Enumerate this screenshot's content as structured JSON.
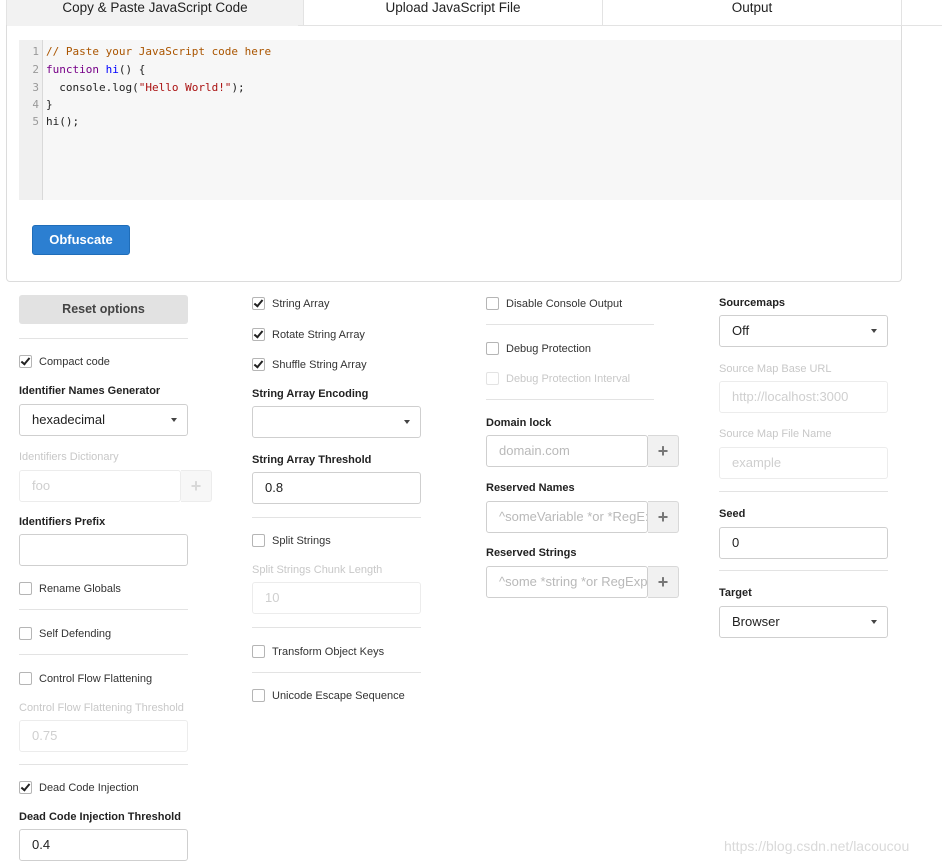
{
  "tabs": [
    {
      "label": "Copy & Paste JavaScript Code"
    },
    {
      "label": "Upload JavaScript File"
    },
    {
      "label": "Output"
    }
  ],
  "editor": {
    "line_numbers": [
      "1",
      "2",
      "3",
      "4",
      "5"
    ],
    "line1": "// Paste your JavaScript code here",
    "line2_kw": "function",
    "line2_fn": "hi",
    "line2_rest": "() {",
    "line3_a": "  console.log(",
    "line3_str": "\"Hello World!\"",
    "line3_b": ");",
    "line4": "}",
    "line5": "hi();"
  },
  "obfuscate_label": "Obfuscate",
  "col1": {
    "reset_label": "Reset options",
    "compact_code": {
      "label": "Compact code",
      "checked": true
    },
    "identifier_names_generator": {
      "label": "Identifier Names Generator",
      "value": "hexadecimal"
    },
    "identifiers_dictionary": {
      "label": "Identifiers Dictionary",
      "placeholder": "foo"
    },
    "identifiers_prefix": {
      "label": "Identifiers Prefix",
      "value": ""
    },
    "rename_globals": {
      "label": "Rename Globals",
      "checked": false
    },
    "self_defending": {
      "label": "Self Defending",
      "checked": false
    },
    "control_flow_flattening": {
      "label": "Control Flow Flattening",
      "checked": false
    },
    "control_flow_threshold": {
      "label": "Control Flow Flattening Threshold",
      "value": "0.75"
    },
    "dead_code_injection": {
      "label": "Dead Code Injection",
      "checked": true
    },
    "dead_code_threshold": {
      "label": "Dead Code Injection Threshold",
      "value": "0.4"
    }
  },
  "col2": {
    "string_array": {
      "label": "String Array",
      "checked": true
    },
    "rotate_string_array": {
      "label": "Rotate String Array",
      "checked": true
    },
    "shuffle_string_array": {
      "label": "Shuffle String Array",
      "checked": true
    },
    "string_array_encoding": {
      "label": "String Array Encoding",
      "value": ""
    },
    "string_array_threshold": {
      "label": "String Array Threshold",
      "value": "0.8"
    },
    "split_strings": {
      "label": "Split Strings",
      "checked": false
    },
    "split_strings_chunk_length": {
      "label": "Split Strings Chunk Length",
      "value": "10"
    },
    "transform_object_keys": {
      "label": "Transform Object Keys",
      "checked": false
    },
    "unicode_escape_sequence": {
      "label": "Unicode Escape Sequence",
      "checked": false
    }
  },
  "col3": {
    "disable_console_output": {
      "label": "Disable Console Output",
      "checked": false
    },
    "debug_protection": {
      "label": "Debug Protection",
      "checked": false
    },
    "debug_protection_interval": {
      "label": "Debug Protection Interval",
      "checked": false
    },
    "domain_lock": {
      "label": "Domain lock",
      "placeholder": "domain.com"
    },
    "reserved_names": {
      "label": "Reserved Names",
      "placeholder": "^someVariable *or *RegE:"
    },
    "reserved_strings": {
      "label": "Reserved Strings",
      "placeholder": "^some *string *or RegExp"
    },
    "add_symbol": "+"
  },
  "col4": {
    "sourcemaps": {
      "label": "Sourcemaps",
      "value": "Off"
    },
    "source_map_base_url": {
      "label": "Source Map Base URL",
      "placeholder": "http://localhost:3000"
    },
    "source_map_file_name": {
      "label": "Source Map File Name",
      "placeholder": "example"
    },
    "seed": {
      "label": "Seed",
      "value": "0"
    },
    "target": {
      "label": "Target",
      "value": "Browser"
    }
  },
  "watermark": "https://blog.csdn.net/lacoucou"
}
